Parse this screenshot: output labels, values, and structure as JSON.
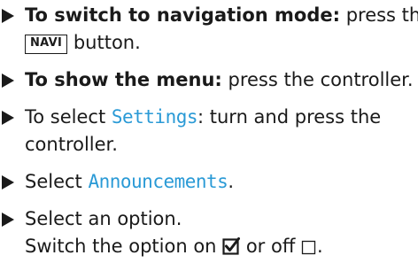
{
  "steps": [
    {
      "bold_lead": "To switch to navigation mode:",
      "text_after": " press the",
      "key_label": "NAVI",
      "text_after_key": " button."
    },
    {
      "bold_lead": "To show the menu:",
      "text_after": " press the controller."
    },
    {
      "text_before": "To select ",
      "display_word": "Settings",
      "text_after": ": turn and press the",
      "line2": "controller."
    },
    {
      "text_before": "Select ",
      "display_word": "Announcements",
      "text_after": "."
    },
    {
      "line1": "Select an option.",
      "line2_before": "Switch the option on ",
      "line2_middle": " or off ",
      "line2_end": "."
    }
  ],
  "icons": {
    "bullet": "arrow-right-icon",
    "checked": "checkbox-checked-icon",
    "unchecked": "checkbox-unchecked-icon"
  },
  "colors": {
    "text": "#1a1a1a",
    "display_text": "#2a9ad6"
  }
}
